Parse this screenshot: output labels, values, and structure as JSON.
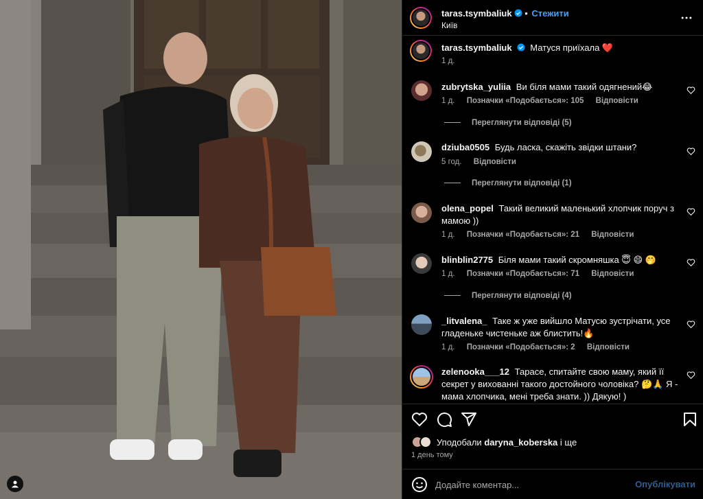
{
  "post": {
    "author": "taras.tsymbaliuk",
    "follow_label": "Стежити",
    "location": "Київ",
    "caption_text": "Матуся приїхала ❤️",
    "caption_time": "1 д."
  },
  "comments": [
    {
      "username": "zubrytska_yuliia",
      "text": "Ви біля мами такий одягнений😂",
      "time": "1 д.",
      "likes": "Позначки «Подобається»: 105",
      "reply_label": "Відповісти",
      "view_replies": "Переглянути відповіді (5)"
    },
    {
      "username": "dziuba0505",
      "text": "Будь ласка, скажіть звідки штани?",
      "time": "5 год.",
      "reply_label": "Відповісти",
      "view_replies": "Переглянути відповіді (1)"
    },
    {
      "username": "olena_popel",
      "text": "Такий великий маленький хлопчик поруч з мамою ))",
      "time": "1 д.",
      "likes": "Позначки «Подобається»: 21",
      "reply_label": "Відповісти"
    },
    {
      "username": "blinblin2775",
      "text": "Біля мами такий скромняшка 😇 😄 🤭",
      "time": "1 д.",
      "likes": "Позначки «Подобається»: 71",
      "reply_label": "Відповісти",
      "view_replies": "Переглянути відповіді (4)"
    },
    {
      "username": "_litvalena_",
      "text": "Таке ж уже вийшло Матусю зустрічати, усе гладеньке чистеньке аж блистить!🔥",
      "time": "1 д.",
      "likes": "Позначки «Подобається»: 2",
      "reply_label": "Відповісти"
    },
    {
      "username": "zelenooka___12",
      "text": "Тарасе, спитайте свою маму, який її секрет у вихованні такого достойного чоловіка? 🤔🙏 Я - мама хлопчика, мені треба знати. )) Дякую! )"
    }
  ],
  "likes_summary": {
    "prefix": "Уподобали",
    "user": "daryna_koberska",
    "suffix": "і ще"
  },
  "date_posted": "1 день тому",
  "add_comment": {
    "placeholder": "Додайте коментар...",
    "post_label": "Опублікувати"
  },
  "icons": {
    "verified": "verified-badge-icon",
    "more": "more-options-icon",
    "like": "heart-icon",
    "comment": "comment-icon",
    "share": "share-icon",
    "save": "bookmark-icon",
    "emoji": "emoji-icon",
    "user_tag": "user-tag-icon"
  },
  "colors": {
    "accent": "#0095f6",
    "background": "#000000",
    "text": "#f5f5f5",
    "muted": "#a8a8a8"
  }
}
